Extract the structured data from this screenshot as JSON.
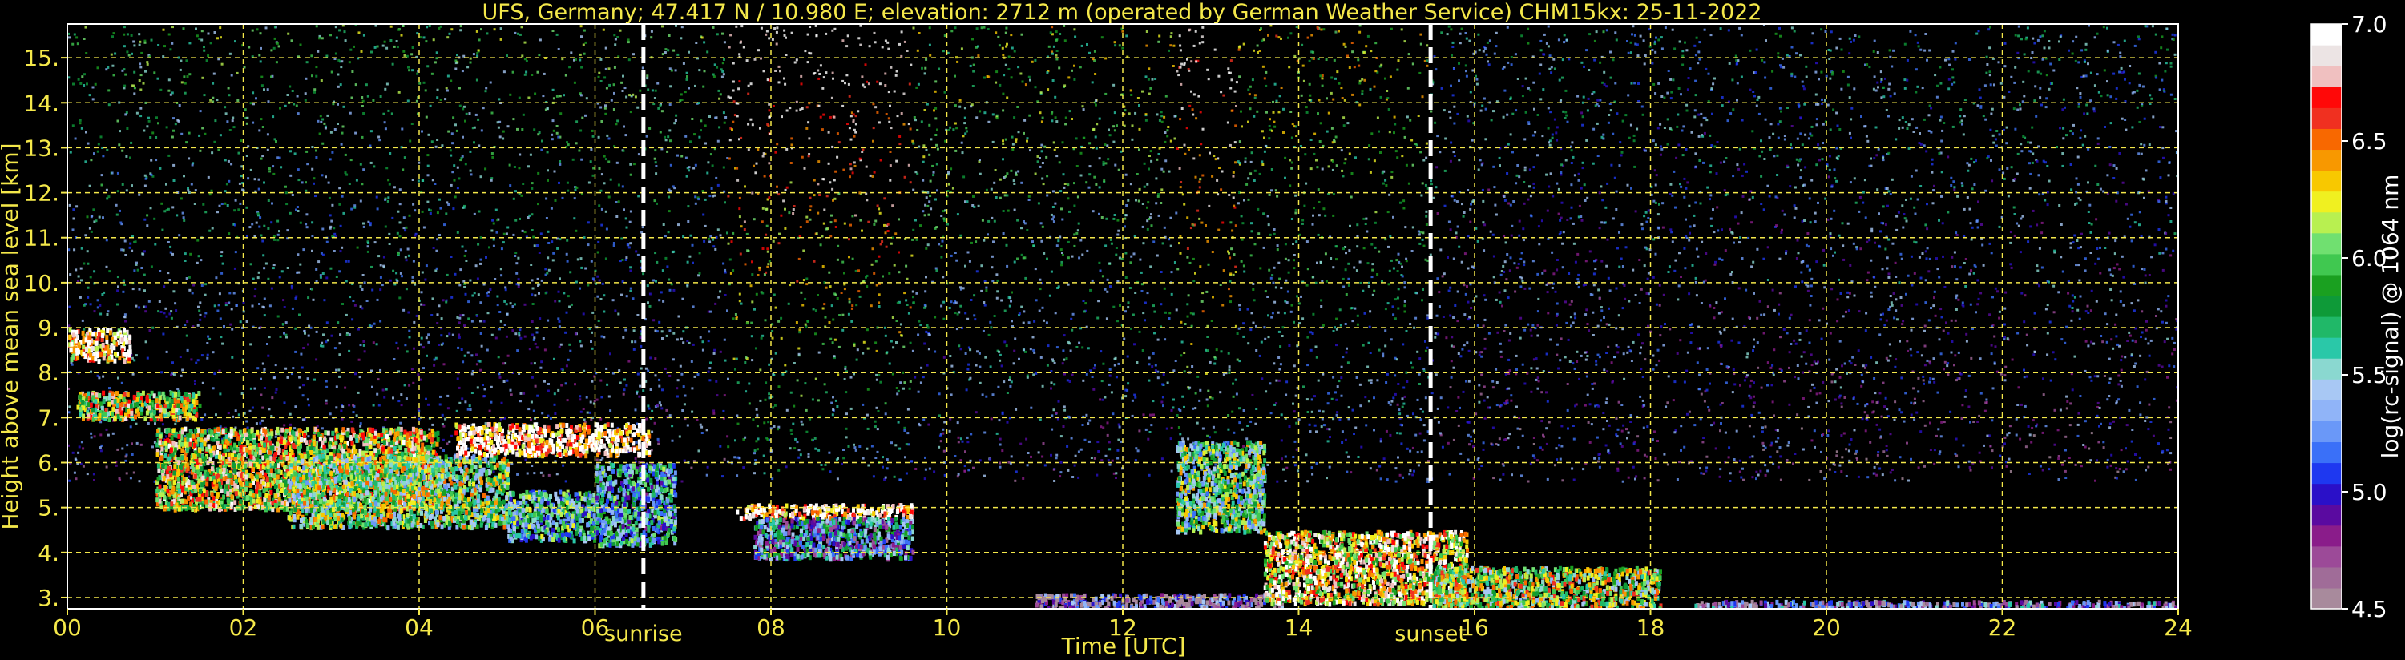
{
  "chart_data": {
    "type": "heatmap",
    "title": "UFS, Germany; 47.417 N / 10.980 E; elevation: 2712 m  (operated by German Weather Service)    CHM15kx: 25-11-2022",
    "xlabel": "Time [UTC]",
    "ylabel": "Height above mean sea level [km]",
    "xlim": [
      0,
      24
    ],
    "ylim": [
      2.75,
      15.75
    ],
    "x_ticks": [
      0,
      2,
      4,
      6,
      8,
      10,
      12,
      14,
      16,
      18,
      20,
      22,
      24
    ],
    "x_tick_labels": [
      "00",
      "02",
      "04",
      "06",
      "08",
      "10",
      "12",
      "14",
      "16",
      "18",
      "20",
      "22",
      "24"
    ],
    "y_ticks": [
      3,
      4,
      5,
      6,
      7,
      8,
      9,
      10,
      11,
      12,
      13,
      14,
      15
    ],
    "y_tick_labels": [
      "3.",
      "4.",
      "5.",
      "6.",
      "7.",
      "8.",
      "9.",
      "10.",
      "11.",
      "12.",
      "13.",
      "14.",
      "15."
    ],
    "grid": true,
    "events": [
      {
        "label": "sunrise",
        "time": 6.55
      },
      {
        "label": "sunset",
        "time": 15.5
      }
    ],
    "colorbar": {
      "label": "log(rc-signal) @ 1064 nm",
      "range": [
        4.5,
        7.0
      ],
      "ticks": [
        4.5,
        5.0,
        5.5,
        6.0,
        6.5,
        7.0
      ],
      "tick_labels": [
        "4.5",
        "5.0",
        "5.5",
        "6.0",
        "6.5",
        "7.0"
      ],
      "colors": [
        "#a88a9c",
        "#a06c98",
        "#9c4a98",
        "#8a1c8a",
        "#5a0aa0",
        "#2a10c8",
        "#1e38f0",
        "#3a70f8",
        "#6a98f8",
        "#90b4f8",
        "#a8c8f4",
        "#8ad8d0",
        "#2ac8a8",
        "#20b868",
        "#0e9a38",
        "#1aa020",
        "#40c850",
        "#70e070",
        "#b8f050",
        "#f0f020",
        "#f8c800",
        "#f89800",
        "#f86800",
        "#f03020",
        "#ff0808",
        "#f0c0c0",
        "#ece4e4",
        "#ffffff"
      ]
    },
    "cloud_layers": [
      {
        "t": [
          0.0,
          0.7
        ],
        "h": [
          8.3,
          9.0
        ],
        "v": 6.7
      },
      {
        "t": [
          0.1,
          1.5
        ],
        "h": [
          7.0,
          7.6
        ],
        "v": 6.2
      },
      {
        "t": [
          1.0,
          4.2
        ],
        "h": [
          5.0,
          6.8
        ],
        "v": 6.3
      },
      {
        "t": [
          2.5,
          5.0
        ],
        "h": [
          4.6,
          6.2
        ],
        "v": 5.9
      },
      {
        "t": [
          4.4,
          6.6
        ],
        "h": [
          6.2,
          6.9
        ],
        "v": 6.8
      },
      {
        "t": [
          5.0,
          6.0
        ],
        "h": [
          4.3,
          5.4
        ],
        "v": 5.6
      },
      {
        "t": [
          6.0,
          6.9
        ],
        "h": [
          4.2,
          6.0
        ],
        "v": 5.5
      },
      {
        "t": [
          7.6,
          9.6
        ],
        "h": [
          4.8,
          5.1
        ],
        "v": 6.8
      },
      {
        "t": [
          7.8,
          9.6
        ],
        "h": [
          3.9,
          4.8
        ],
        "v": 5.3
      },
      {
        "t": [
          11.0,
          13.8
        ],
        "h": [
          2.8,
          3.1
        ],
        "v": 4.8
      },
      {
        "t": [
          12.6,
          13.6
        ],
        "h": [
          4.5,
          6.5
        ],
        "v": 5.8
      },
      {
        "t": [
          13.6,
          15.9
        ],
        "h": [
          2.9,
          4.5
        ],
        "v": 6.5
      },
      {
        "t": [
          15.5,
          18.1
        ],
        "h": [
          2.8,
          3.7
        ],
        "v": 6.0
      },
      {
        "t": [
          18.5,
          24.0
        ],
        "h": [
          2.8,
          2.95
        ],
        "v": 5.0
      }
    ],
    "noise_bands": [
      {
        "t": [
          0.0,
          7.5
        ],
        "v": 5.4
      },
      {
        "t": [
          7.5,
          9.6
        ],
        "v": 6.6
      },
      {
        "t": [
          9.6,
          12.6
        ],
        "v": 5.6
      },
      {
        "t": [
          12.6,
          13.3
        ],
        "v": 6.6
      },
      {
        "t": [
          13.3,
          15.5
        ],
        "v": 5.7
      },
      {
        "t": [
          15.5,
          24.0
        ],
        "v": 5.1
      }
    ]
  }
}
